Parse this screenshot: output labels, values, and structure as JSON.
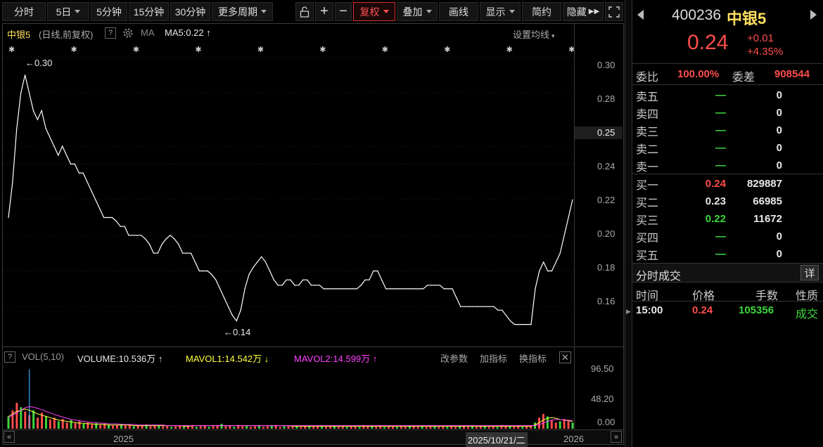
{
  "toolbar": {
    "items": [
      "分时",
      "5日",
      "5分钟",
      "15分钟",
      "30分钟",
      "更多周期"
    ],
    "adjust": "复权",
    "overlay": "叠加",
    "draw": "画线",
    "display": "显示",
    "simple": "简约",
    "hide": "隐藏"
  },
  "chart_header": {
    "name": "中银5",
    "mode": "(日线,前复权)",
    "help": "?",
    "ma_label": "MA",
    "ma5": "MA5:0.22",
    "settings": "设置均线"
  },
  "annotations": {
    "high": "←0.30",
    "low": "←0.14"
  },
  "price_axis": [
    "0.30",
    "0.28",
    "0.25",
    "0.24",
    "0.22",
    "0.20",
    "0.18",
    "0.16"
  ],
  "vol_header": {
    "help": "?",
    "label": "VOL(5,10)",
    "volume": "VOLUME:10.536万",
    "mavol1": "MAVOL1:14.542万",
    "mavol2": "MAVOL2:14.599万",
    "params": "改参数",
    "add": "加指标",
    "switch": "换指标"
  },
  "vol_axis": [
    "96.50",
    "48.20",
    "0.00"
  ],
  "time_axis": {
    "year1": "2025",
    "cursor": "2025/10/21/二",
    "year2": "2026"
  },
  "quote": {
    "code": "400236",
    "name": "中银5",
    "price": "0.24",
    "change": "+0.01",
    "pct": "+4.35%"
  },
  "ratio": {
    "label1": "委比",
    "val1": "100.00%",
    "label2": "委差",
    "val2": "908544"
  },
  "asks": [
    {
      "label": "卖五",
      "price": "—",
      "vol": "0"
    },
    {
      "label": "卖四",
      "price": "—",
      "vol": "0"
    },
    {
      "label": "卖三",
      "price": "—",
      "vol": "0"
    },
    {
      "label": "卖二",
      "price": "—",
      "vol": "0"
    },
    {
      "label": "卖一",
      "price": "—",
      "vol": "0"
    }
  ],
  "bids": [
    {
      "label": "买一",
      "price": "0.24",
      "vol": "829887"
    },
    {
      "label": "买二",
      "price": "0.23",
      "vol": "66985"
    },
    {
      "label": "买三",
      "price": "0.22",
      "vol": "11672"
    },
    {
      "label": "买四",
      "price": "—",
      "vol": "0"
    },
    {
      "label": "买五",
      "price": "—",
      "vol": "0"
    }
  ],
  "trades": {
    "title": "分时成交",
    "detail": "详",
    "headers": [
      "时间",
      "价格",
      "手数",
      "性质"
    ],
    "rows": [
      {
        "time": "15:00",
        "price": "0.24",
        "vol": "105356",
        "type": "成交"
      }
    ]
  },
  "chart_data": {
    "type": "line",
    "price_ylim": [
      0.138,
      0.31
    ],
    "price_series": [
      0.21,
      0.23,
      0.26,
      0.28,
      0.29,
      0.28,
      0.27,
      0.265,
      0.27,
      0.26,
      0.255,
      0.25,
      0.245,
      0.25,
      0.245,
      0.24,
      0.24,
      0.235,
      0.235,
      0.23,
      0.225,
      0.22,
      0.215,
      0.21,
      0.21,
      0.21,
      0.208,
      0.205,
      0.205,
      0.2,
      0.2,
      0.2,
      0.2,
      0.198,
      0.195,
      0.19,
      0.19,
      0.195,
      0.198,
      0.2,
      0.198,
      0.195,
      0.19,
      0.19,
      0.19,
      0.185,
      0.18,
      0.18,
      0.18,
      0.178,
      0.175,
      0.17,
      0.165,
      0.16,
      0.155,
      0.152,
      0.158,
      0.17,
      0.178,
      0.182,
      0.185,
      0.188,
      0.185,
      0.18,
      0.175,
      0.172,
      0.172,
      0.175,
      0.175,
      0.172,
      0.172,
      0.175,
      0.175,
      0.172,
      0.172,
      0.172,
      0.17,
      0.17,
      0.17,
      0.17,
      0.17,
      0.17,
      0.17,
      0.17,
      0.17,
      0.172,
      0.175,
      0.175,
      0.18,
      0.18,
      0.175,
      0.17,
      0.17,
      0.17,
      0.17,
      0.17,
      0.17,
      0.17,
      0.17,
      0.17,
      0.17,
      0.172,
      0.172,
      0.172,
      0.172,
      0.17,
      0.17,
      0.17,
      0.165,
      0.16,
      0.16,
      0.16,
      0.16,
      0.16,
      0.16,
      0.16,
      0.16,
      0.16,
      0.158,
      0.158,
      0.155,
      0.152,
      0.15,
      0.15,
      0.15,
      0.15,
      0.15,
      0.17,
      0.18,
      0.185,
      0.18,
      0.18,
      0.185,
      0.19,
      0.2,
      0.21,
      0.22
    ],
    "volume_ylim": [
      0,
      105
    ],
    "volume_series": [
      20,
      30,
      42,
      35,
      28,
      22,
      30,
      18,
      26,
      20,
      15,
      18,
      12,
      16,
      10,
      14,
      9,
      12,
      8,
      10,
      7,
      9,
      6,
      8,
      7,
      5,
      6,
      8,
      5,
      6,
      4,
      6,
      5,
      7,
      4,
      5,
      6,
      4,
      5,
      3,
      4,
      5,
      3,
      4,
      6,
      3,
      4,
      5,
      3,
      4,
      6,
      8,
      4,
      5,
      3,
      6,
      4,
      5,
      3,
      4,
      5,
      3,
      4,
      5,
      6,
      3,
      4,
      5,
      3,
      4,
      3,
      5,
      4,
      3,
      4,
      5,
      3,
      4,
      5,
      3,
      4,
      3,
      5,
      4,
      3,
      6,
      4,
      5,
      3,
      4,
      3,
      4,
      5,
      3,
      4,
      3,
      5,
      4,
      3,
      4,
      3,
      4,
      5,
      3,
      4,
      3,
      4,
      3,
      5,
      4,
      3,
      4,
      3,
      4,
      5,
      3,
      4,
      3,
      6,
      4,
      5,
      3,
      4,
      3,
      5,
      4,
      10,
      18,
      24,
      20,
      14,
      10,
      12,
      16,
      12,
      10
    ],
    "volume_spike": {
      "index": 5,
      "value": 96.5
    },
    "ma1_series": [
      20,
      24,
      28,
      30,
      32,
      30,
      27,
      24,
      22,
      20,
      18,
      16,
      14,
      13,
      12,
      11,
      10,
      9,
      9,
      8,
      8,
      7,
      7,
      7,
      6,
      6,
      6,
      6,
      6,
      6,
      5,
      5,
      5,
      5,
      5,
      5,
      5,
      5,
      5,
      5,
      5,
      5,
      4,
      4,
      5,
      5,
      5,
      5,
      5,
      5,
      5,
      5,
      5,
      5,
      5,
      5,
      5,
      5,
      5,
      5,
      5,
      5,
      5,
      5,
      5,
      5,
      5,
      5,
      4,
      4,
      4,
      4,
      4,
      4,
      4,
      4,
      4,
      4,
      4,
      4,
      4,
      4,
      4,
      4,
      4,
      4,
      4,
      4,
      4,
      4,
      4,
      4,
      4,
      4,
      4,
      4,
      4,
      4,
      4,
      4,
      4,
      4,
      4,
      4,
      4,
      4,
      4,
      4,
      4,
      4,
      4,
      4,
      4,
      4,
      4,
      4,
      4,
      4,
      4,
      4,
      4,
      4,
      4,
      4,
      4,
      4,
      6,
      10,
      14,
      17,
      18,
      17,
      15,
      14,
      13,
      12
    ],
    "ma2_series": [
      18,
      22,
      26,
      30,
      34,
      36,
      35,
      33,
      31,
      28,
      26,
      23,
      21,
      19,
      17,
      15,
      14,
      13,
      12,
      11,
      10,
      10,
      9,
      9,
      8,
      8,
      8,
      7,
      7,
      7,
      7,
      6,
      6,
      6,
      6,
      6,
      6,
      6,
      5,
      5,
      5,
      5,
      5,
      5,
      5,
      5,
      5,
      5,
      5,
      5,
      5,
      5,
      5,
      5,
      5,
      5,
      5,
      5,
      5,
      5,
      5,
      5,
      5,
      5,
      5,
      5,
      5,
      5,
      5,
      5,
      5,
      5,
      5,
      5,
      5,
      5,
      5,
      5,
      5,
      5,
      5,
      5,
      5,
      5,
      5,
      5,
      5,
      5,
      5,
      5,
      5,
      5,
      5,
      5,
      5,
      5,
      5,
      5,
      5,
      5,
      5,
      5,
      5,
      5,
      5,
      5,
      5,
      5,
      5,
      5,
      5,
      5,
      5,
      5,
      5,
      5,
      5,
      5,
      5,
      5,
      5,
      5,
      5,
      5,
      5,
      5,
      5,
      7,
      9,
      12,
      14,
      15,
      15,
      14,
      14,
      13
    ]
  },
  "colors": {
    "up": "#ff4d4d",
    "down": "#3dd63d",
    "line": "#ffffff",
    "mavol1": "#ffff40",
    "mavol2": "#ff40ff",
    "grid": "#2a2a2a"
  }
}
